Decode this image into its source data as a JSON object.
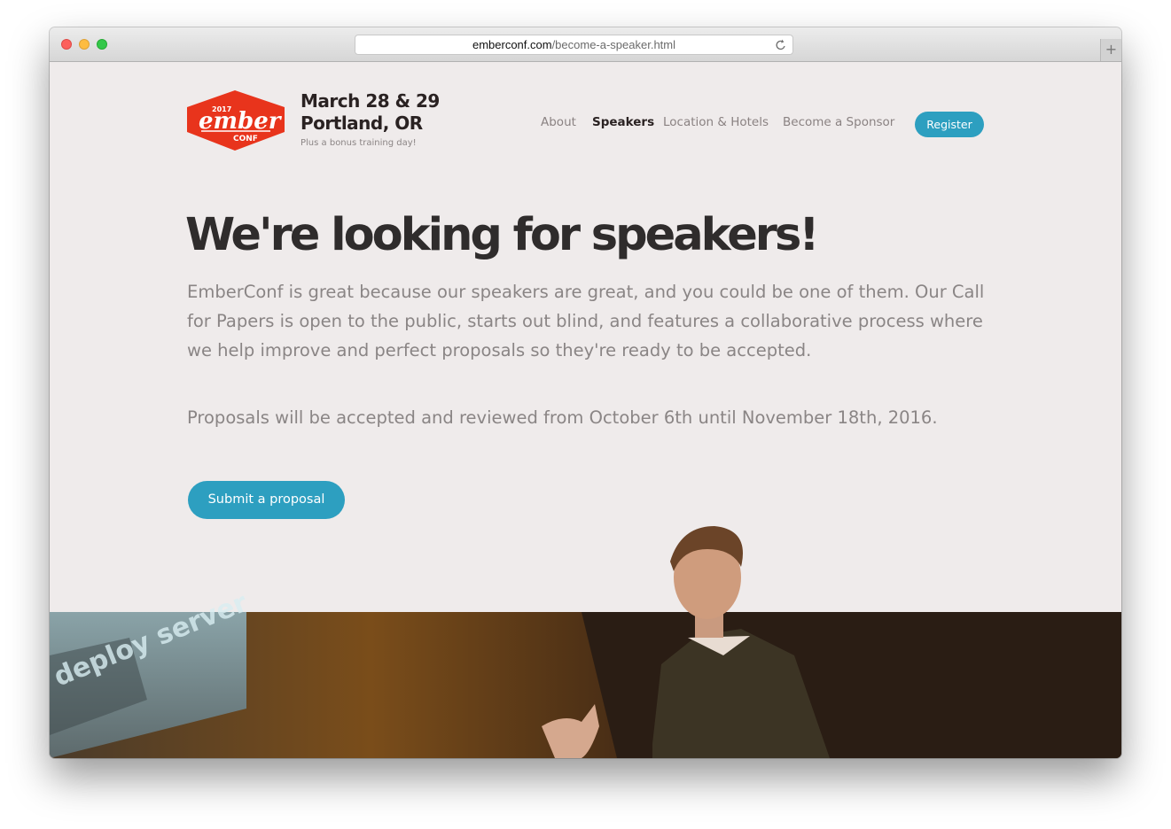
{
  "browser": {
    "url_host": "emberconf.com",
    "url_path": "/become-a-speaker.html",
    "new_tab_label": "+"
  },
  "site": {
    "logo": {
      "year": "2017",
      "word": "ember",
      "sub": "CONF",
      "color": "#e8341c"
    },
    "event_date_line1": "March 28 & 29",
    "event_date_line2": "Portland, OR",
    "event_subtitle": "Plus a bonus training day!"
  },
  "nav": {
    "items": [
      {
        "label": "About",
        "active": false
      },
      {
        "label": "Speakers",
        "active": true
      },
      {
        "label": "Location & Hotels",
        "active": false
      },
      {
        "label": "Become a Sponsor",
        "active": false
      }
    ],
    "register_label": "Register"
  },
  "hero": {
    "headline": "We're looking for speakers!",
    "intro": "EmberConf is great because our speakers are great, and you could be one of them. Our Call for Papers is open to the public, starts out blind, and features a collaborative process where we help improve and perfect proposals so they're ready to be accepted.",
    "dates_text": "Proposals will be accepted and reviewed from October 6th until November 18th, 2016.",
    "submit_label": "Submit a proposal"
  },
  "photo": {
    "screen_text": "deploy server"
  },
  "colors": {
    "accent": "#2d9fc0",
    "background": "#efebeb",
    "heading": "#2f2c2c",
    "body_text": "#8a8585"
  }
}
